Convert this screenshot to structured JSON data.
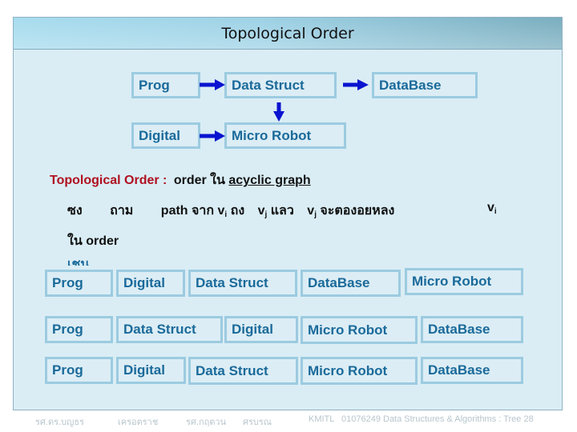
{
  "slide": {
    "title": "Topological Order"
  },
  "diagram": {
    "nodes": [
      {
        "id": "prog",
        "label": "Prog"
      },
      {
        "id": "datastruct",
        "label": "Data Struct"
      },
      {
        "id": "database",
        "label": "DataBase"
      },
      {
        "id": "digital",
        "label": "Digital"
      },
      {
        "id": "microrobot",
        "label": "Micro Robot"
      }
    ],
    "edges": [
      {
        "from": "prog",
        "to": "datastruct"
      },
      {
        "from": "datastruct",
        "to": "database"
      },
      {
        "from": "datastruct",
        "to": "microrobot"
      },
      {
        "from": "digital",
        "to": "microrobot"
      }
    ],
    "arrow_color": "#0a14d0"
  },
  "definition": {
    "term": "Topological Order :",
    "text_1": "order ใน",
    "link": "acyclic graph",
    "line2_word1": "ซง",
    "line2_word2": "ถาม",
    "line2_path": "path จาก v",
    "line2_sub_i": "i",
    "line2_to": " ถง",
    "line2_vj": "v",
    "line2_sub_j": "j",
    "line2_then": " แลว",
    "line2_vj2": "v",
    "line2_sub_j2": "j",
    "line2_must": " จะตองอยหลง",
    "line2_vi": "v",
    "line2_sub_i2": "i",
    "line3": "ใน order",
    "example_label": "เชน"
  },
  "examples": [
    [
      "Prog",
      "Digital",
      "Data Struct",
      "DataBase",
      "Micro Robot"
    ],
    [
      "Prog",
      "Data Struct",
      "Digital",
      "Micro Robot",
      "DataBase"
    ],
    [
      "Prog",
      "Digital",
      "Data Struct",
      "Micro Robot",
      "DataBase"
    ]
  ],
  "footer": {
    "author1": "รศ.ดร.บญธร",
    "author1_last": "เครอตราช",
    "author2": "รศ.กฤตวน",
    "author2_last": "ศรบรณ",
    "institution": "KMITL",
    "course": "01076249 Data Structures & Algorithms : Tree 28"
  },
  "colors": {
    "box_text": "#1a6a9a",
    "box_border": "#9ccbe0",
    "panel_bg": "#daedf5",
    "term_red": "#b01020"
  }
}
